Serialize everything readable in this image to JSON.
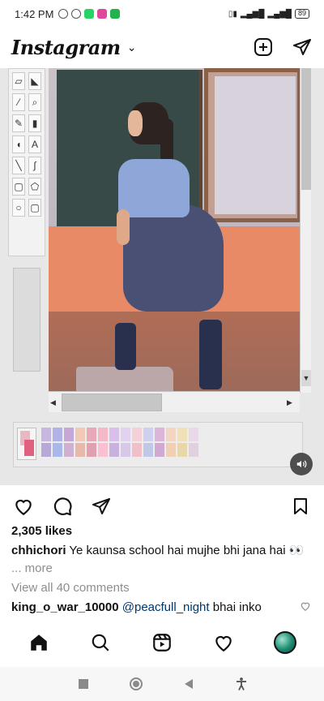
{
  "status_bar": {
    "time": "1:42 PM",
    "battery": "89",
    "notification_icons": [
      "mute-icon",
      "alarm-icon",
      "whatsapp-icon",
      "messenger-icon",
      "phone-icon"
    ],
    "signal_icons": [
      "data-icon",
      "signal-icon",
      "signal-icon"
    ]
  },
  "header": {
    "logo": "Instagram",
    "chevron_icon": "chevron-down-icon",
    "new_post_icon": "plus-square-icon",
    "direct_icon": "send-icon"
  },
  "post": {
    "likes": "2,305 likes",
    "caption_user": "chhichori",
    "caption_text": " Ye kaunsa school hai mujhe bhi jana hai 👀",
    "more": "... more",
    "view_comments": "View all 40 comments",
    "comment_user": "king_o_war_10000",
    "comment_mention": "@peacfull_night",
    "comment_text": " bhai inko"
  },
  "actions": {
    "like_icon": "heart-icon",
    "comment_icon": "comment-icon",
    "share_icon": "send-icon",
    "save_icon": "bookmark-icon"
  },
  "bottom_nav": [
    "home-icon",
    "search-icon",
    "reels-icon",
    "heart-icon",
    "profile-avatar"
  ],
  "colors": {
    "accent": "#0095f6",
    "text": "#111111",
    "muted": "#8e8e8e",
    "mention": "#00376b"
  },
  "palette_colors": [
    "#c6b6e0",
    "#b2b2e6",
    "#c7a6d8",
    "#f2c9b6",
    "#e8a8b8",
    "#f4b8c8",
    "#d8c0ea",
    "#e2d2f0",
    "#f4d0d8",
    "#cfd0f0",
    "#dcb6d8",
    "#f4d6c0",
    "#f0e0b8",
    "#e8d8e8",
    "#b8a8d8",
    "#a8b8e8",
    "#d0b0d0",
    "#e8b8a8",
    "#e0a0b0",
    "#f8c0d0",
    "#c8b0e0",
    "#d8c8e8",
    "#f0c0c8",
    "#c0c8e8",
    "#d0a8d0",
    "#f0d0b0",
    "#e8d8a8",
    "#e0d0e0"
  ]
}
